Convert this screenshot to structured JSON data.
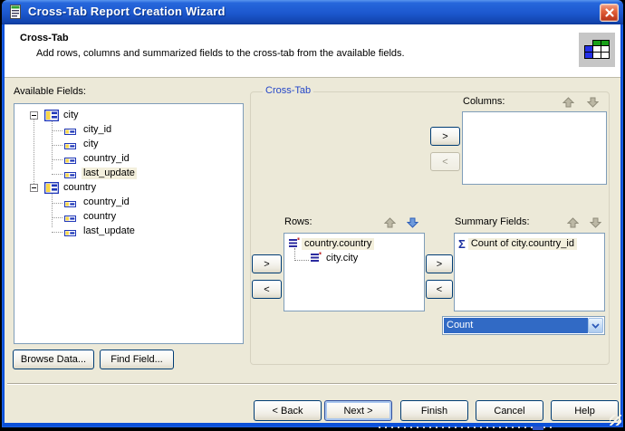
{
  "window": {
    "title": "Cross-Tab Report Creation Wizard"
  },
  "header": {
    "title": "Cross-Tab",
    "description": "Add rows, columns and summarized fields to the cross-tab from the available fields."
  },
  "fields_panel": {
    "label": "Available Fields:",
    "tree": [
      {
        "label": "city",
        "children": [
          {
            "label": "city_id"
          },
          {
            "label": "city"
          },
          {
            "label": "country_id"
          },
          {
            "label": "last_update",
            "selected": true
          }
        ]
      },
      {
        "label": "country",
        "children": [
          {
            "label": "country_id"
          },
          {
            "label": "country"
          },
          {
            "label": "last_update"
          }
        ]
      }
    ],
    "browse_button": "Browse Data...",
    "find_button": "Find Field..."
  },
  "crosstab": {
    "group_label": "Cross-Tab",
    "move_right": ">",
    "move_left": "<",
    "columns": {
      "label": "Columns:",
      "items": []
    },
    "rows": {
      "label": "Rows:",
      "items": [
        {
          "label": "country.country",
          "selected": true
        },
        {
          "label": "city.city"
        }
      ]
    },
    "summary": {
      "label": "Summary Fields:",
      "sigma_icon": "Σ",
      "items": [
        {
          "label": "Count of city.country_id",
          "selected": true
        }
      ]
    },
    "summary_function": {
      "value": "Count"
    }
  },
  "footer": {
    "back": "< Back",
    "next": "Next >",
    "finish": "Finish",
    "cancel": "Cancel",
    "help": "Help"
  },
  "colors": {
    "titlebar_blue": "#1C57CE",
    "window_border": "#0C50D8",
    "dialog_bg": "#ECE9D8",
    "selection_blue": "#316AC5",
    "item_highlight": "#F3EFDC",
    "group_label_blue": "#2446C8"
  }
}
